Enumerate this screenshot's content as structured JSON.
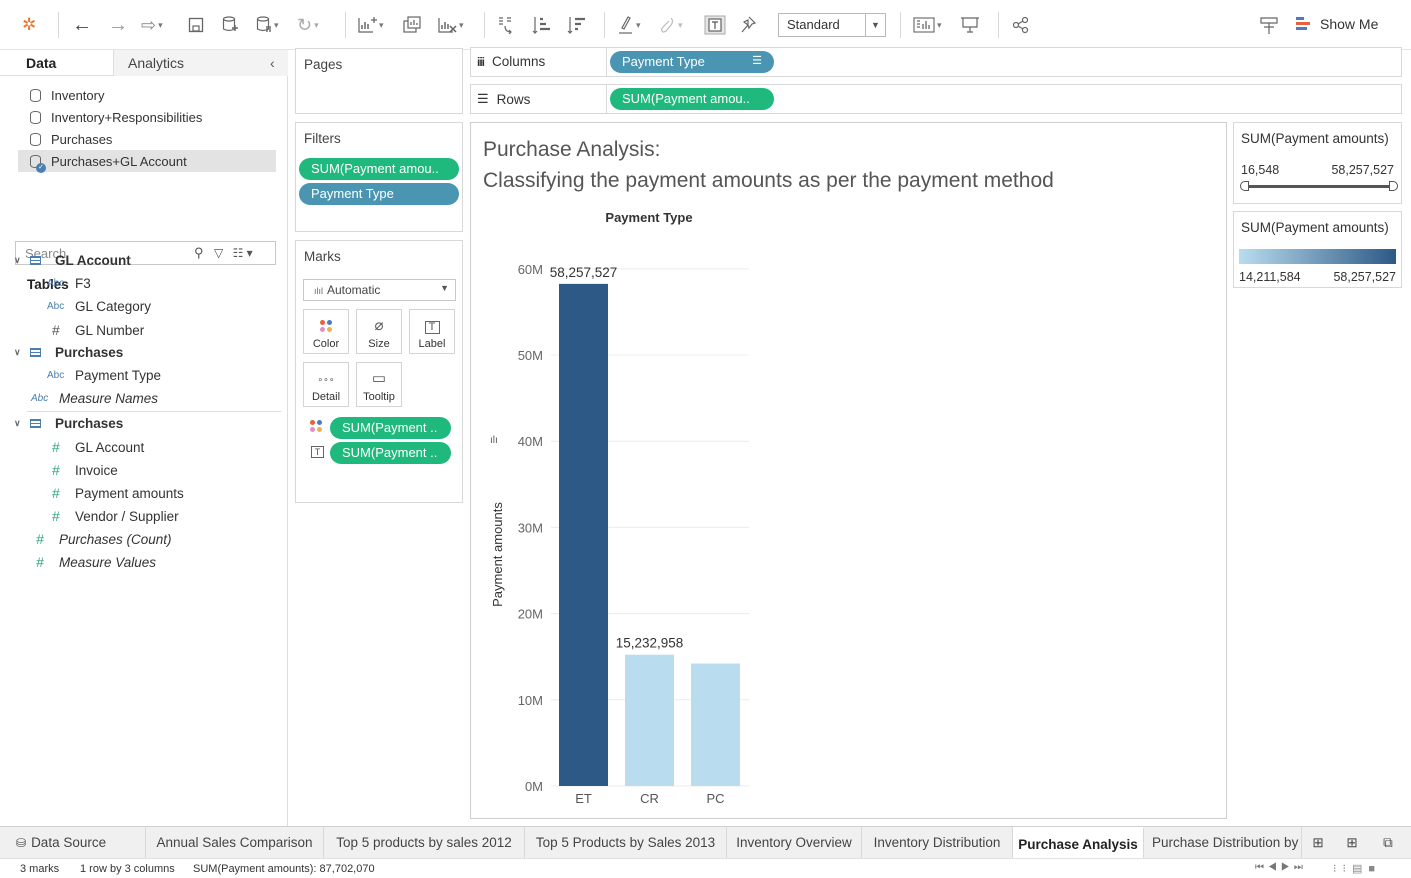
{
  "toolbar": {
    "view_mode": "Standard",
    "show_me": "Show Me"
  },
  "data_pane": {
    "tab_data": "Data",
    "tab_analytics": "Analytics",
    "data_sources": [
      "Inventory",
      "Inventory+Responsibilities",
      "Purchases",
      "Purchases+GL Account"
    ],
    "selected_source": "Purchases+GL Account",
    "search_placeholder": "Search",
    "tables_heading": "Tables",
    "gl_account_table": "GL Account",
    "gl_fields": [
      "F3",
      "GL Category",
      "GL Number"
    ],
    "purchases_table_dim": "Purchases",
    "purchases_dim_fields": [
      "Payment Type"
    ],
    "measure_names": "Measure Names",
    "purchases_table_meas": "Purchases",
    "purchases_meas_fields": [
      "GL Account",
      "Invoice",
      "Payment amounts",
      "Vendor / Supplier"
    ],
    "purchases_count": "Purchases (Count)",
    "measure_values": "Measure Values",
    "type_abc": "Abc",
    "type_num": "#"
  },
  "pages": {
    "title": "Pages"
  },
  "filters": {
    "title": "Filters",
    "pills": [
      "SUM(Payment amou..",
      "Payment Type"
    ]
  },
  "marks": {
    "title": "Marks",
    "type": "Automatic",
    "buttons": [
      "Color",
      "Size",
      "Label",
      "Detail",
      "Tooltip"
    ],
    "pills": [
      "SUM(Payment ..",
      "SUM(Payment .."
    ]
  },
  "columns": {
    "label": "Columns",
    "pill": "Payment Type"
  },
  "rows": {
    "label": "Rows",
    "pill": "SUM(Payment amou.."
  },
  "viz": {
    "title_line1": "Purchase Analysis:",
    "title_line2": "Classifying the payment amounts as per the payment method"
  },
  "legends": {
    "filter_title": "SUM(Payment amounts)",
    "filter_min": "16,548",
    "filter_max": "58,257,527",
    "color_title": "SUM(Payment amounts)",
    "color_min": "14,211,584",
    "color_max": "58,257,527",
    "color_low": "#b9dcef",
    "color_high": "#2c5985"
  },
  "chart_data": {
    "type": "bar",
    "title": "",
    "xlabel": "Payment Type",
    "ylabel": "Payment amounts",
    "categories": [
      "ET",
      "CR",
      "PC"
    ],
    "values": [
      58257527,
      15232958,
      14211584
    ],
    "data_labels": [
      "58,257,527",
      "15,232,958",
      ""
    ],
    "ylim": [
      0,
      63000000
    ],
    "yticks": [
      0,
      10000000,
      20000000,
      30000000,
      40000000,
      50000000,
      60000000
    ],
    "ytick_labels": [
      "0M",
      "10M",
      "20M",
      "30M",
      "40M",
      "50M",
      "60M"
    ],
    "grid": true,
    "colors": [
      "#2c5985",
      "#b9dcef",
      "#b9dcef"
    ]
  },
  "sheet_tabs": {
    "data_source": "Data Source",
    "tabs": [
      "Annual Sales Comparison",
      "Top 5 products by sales 2012",
      "Top 5 Products by Sales 2013",
      "Inventory Overview",
      "Inventory Distribution",
      "Purchase Analysis",
      "Purchase Distribution by"
    ],
    "active": "Purchase Analysis"
  },
  "status_bar": {
    "marks": "3 marks",
    "dims": "1 row by 3 columns",
    "sum": "SUM(Payment amounts): 87,702,070"
  }
}
